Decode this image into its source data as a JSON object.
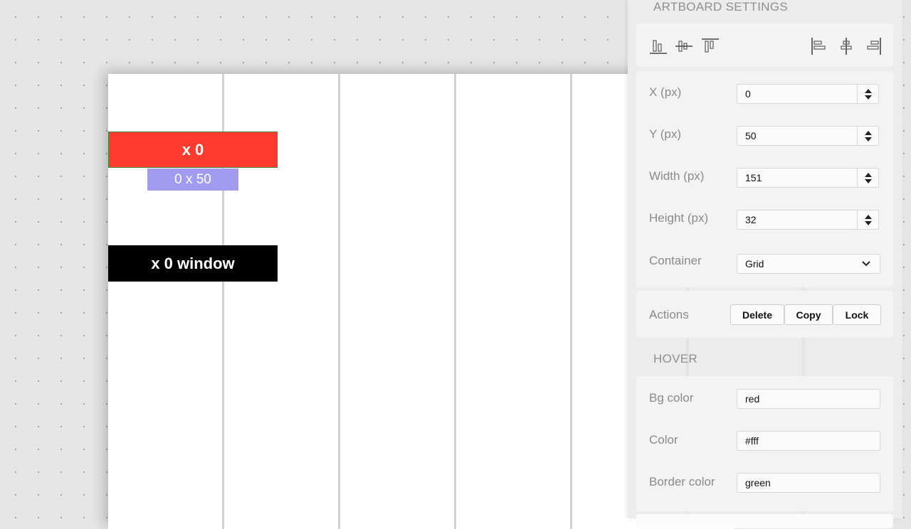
{
  "artboard": {
    "elements": {
      "red_box_label": "x 0",
      "tooltip_label": "0 x 50",
      "black_box_label": "x 0 window"
    }
  },
  "panel": {
    "artboard_settings_title": "ARTBOARD SETTINGS",
    "align_icons": [
      "align-bottom-icon",
      "align-middle-icon",
      "align-top-icon",
      "align-left-icon",
      "align-center-icon",
      "align-right-icon"
    ],
    "fields": {
      "x": {
        "label": "X (px)",
        "value": "0"
      },
      "y": {
        "label": "Y (px)",
        "value": "50"
      },
      "width": {
        "label": "Width (px)",
        "value": "151"
      },
      "height": {
        "label": "Height (px)",
        "value": "32"
      },
      "container": {
        "label": "Container",
        "value": "Grid"
      }
    },
    "actions": {
      "label": "Actions",
      "delete": "Delete",
      "copy": "Copy",
      "lock": "Lock"
    },
    "hover_title": "HOVER",
    "hover": {
      "bg_color": {
        "label": "Bg color",
        "value": "red"
      },
      "color": {
        "label": "Color",
        "value": "#fff"
      },
      "border_color": {
        "label": "Border color",
        "value": "green"
      }
    }
  },
  "colors": {
    "red_box": "#ff3b30",
    "red_box_border": "#3b8a3b",
    "tooltip": "#a19cf0",
    "black_box": "#000000"
  }
}
